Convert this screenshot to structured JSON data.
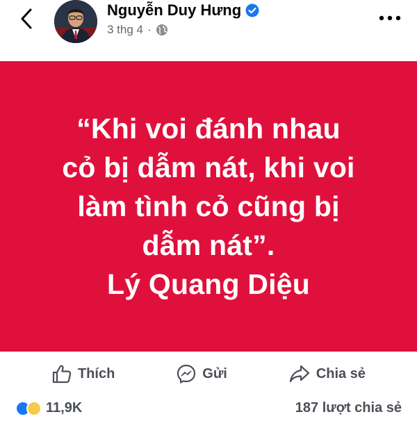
{
  "header": {
    "author_name": "Nguyễn Duy Hưng",
    "post_date": "3 thg 4",
    "separator": "·"
  },
  "post": {
    "background_color": "#e0103c",
    "quote_lines": [
      "“Khi voi đánh nhau",
      "cỏ bị dẫm nát, khi voi",
      "làm tình cỏ cũng bị",
      "dẫm nát”.",
      "Lý Quang Diệu"
    ]
  },
  "actions": {
    "like_label": "Thích",
    "send_label": "Gửi",
    "share_label": "Chia sẻ"
  },
  "stats": {
    "reaction_count": "11,9K",
    "share_count": "187 lượt chia sẻ"
  },
  "icons": {
    "back": "chevron-left-icon",
    "more": "more-horizontal-icon",
    "verified": "verified-badge-icon",
    "audience": "globe-icon",
    "like": "thumbs-up-icon",
    "send": "messenger-icon",
    "share": "share-arrow-icon"
  },
  "colors": {
    "brand_blue": "#1877f2",
    "secondary_text": "#65676b"
  }
}
